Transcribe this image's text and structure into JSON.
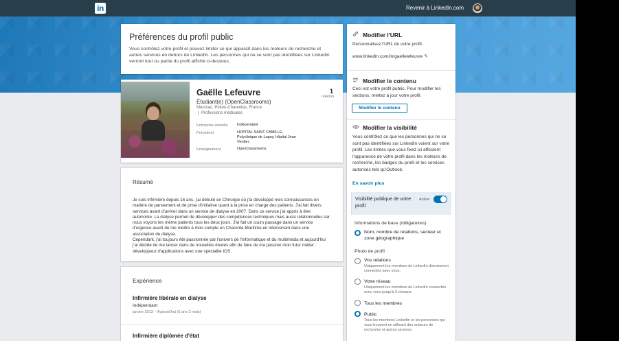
{
  "nav": {
    "logo": "in",
    "back_link": "Revenir à LinkedIn.com"
  },
  "prefs": {
    "title": "Préférences du profil public",
    "description": "Vous contrôlez votre profil et pouvez limiter ce qui apparaît dans les moteurs de recherche et autres services en dehors de LinkedIn. Les personnes qui ne se sont pas identifiées sur LinkedIn verront tout ou partie du profil affiché ci-dessous."
  },
  "profile": {
    "name": "Gaëlle Lefeuvre",
    "headline": "Étudiant(e) (OpenClassrooms)",
    "location": "Meursac, Poitou-Charentes, France",
    "industry": "Professions médicales",
    "connections_count": "1",
    "connections_label": "relation",
    "current_label": "Entreprise actuelle",
    "current_value": "Indépendant",
    "previous_label": "Précédent",
    "previous_value_1": "HOPITAL SAINT CAMILLE,",
    "previous_value_2": "Polyclinique de Lagny, hôpital Jean",
    "previous_value_3": "Verdier",
    "education_label": "Enseignement",
    "education_value": "OpenClassrooms"
  },
  "resume": {
    "title": "Résumé",
    "text": "Je suis infirmière depuis 16 ans, j'ai débuté en Chirurgie où j'ai développé mes connaissances en matière de pansement et de prise d'initiative quant à la prise en charge des patients. J'ai fait divers services avant d'arriver dans un service de dialyse en 2007. Dans ce service j'ai appris à être autonome. La dialyse permet de développer des compétences techniques mais aussi relationnelles car nous voyons les même patients tous les deux jours. J'ai fait un cours passage dans un service d'urgence avant de me mettre à mon compte en Charente-Maritime en intervenant dans une association de dialyse.\nCependant, j'ai toujours été passionnée par l'univers de l'informatique et du multimédia et aujourd'hui j'ai décidé de me lancer dans de nouvelles études afin de faire de ma passion mon futur métier : développeur d'applications avec une spécialité IOS."
  },
  "experience": {
    "title": "Expérience",
    "items": [
      {
        "role": "Infirmière libérale en dialyse",
        "company": "Indépendant",
        "dates": "janvier 2013 – Aujourd'hui (5 ans 2 mois)"
      },
      {
        "role": "Infirmière diplômée d'état"
      }
    ]
  },
  "sidebar": {
    "url": {
      "title": "Modifier l'URL",
      "text": "Personnalisez l'URL de votre profil.",
      "value": "www.linkedin.com/in/gaellelefeuvre"
    },
    "content": {
      "title": "Modifier le contenu",
      "text": "Ceci est votre profil public. Pour modifier les sections, mettez à jour votre profil.",
      "button": "Modifier le contenu"
    },
    "visibility": {
      "title": "Modifier la visibilité",
      "text": "Vous contrôlez ce que les personnes qui ne se sont pas identifiées sur LinkedIn voient sur votre profil. Les limites que vous fixez ici affectent l'apparence de votre profil dans les moteurs de recherche, les badges du profil et les services autorisés tels qu'Outlook.",
      "more_link": "En savoir plus",
      "public_label": "Visibilité publique de votre profil",
      "public_status": "Activé",
      "public_enabled": true,
      "basic_heading": "Informations de base (obligatoires)",
      "basic_option": "Nom, nombre de relations, secteur et zone géographique",
      "photo_heading": "Photo de profil",
      "photo_options": [
        {
          "label": "Vos relations",
          "sub": "Uniquement les membres de LinkedIn directement connectés avec vous.",
          "selected": false
        },
        {
          "label": "Votre réseau",
          "sub": "Uniquement les membres de LinkedIn connectés avec vous jusqu'à 3 niveaux.",
          "selected": false
        },
        {
          "label": "Tous les membres",
          "sub": "",
          "selected": false
        },
        {
          "label": "Public",
          "sub": "Tous les membres LinkedIn et les personnes qui vous trouvent en utilisant des moteurs de recherche et autres services",
          "selected": true
        }
      ]
    }
  }
}
